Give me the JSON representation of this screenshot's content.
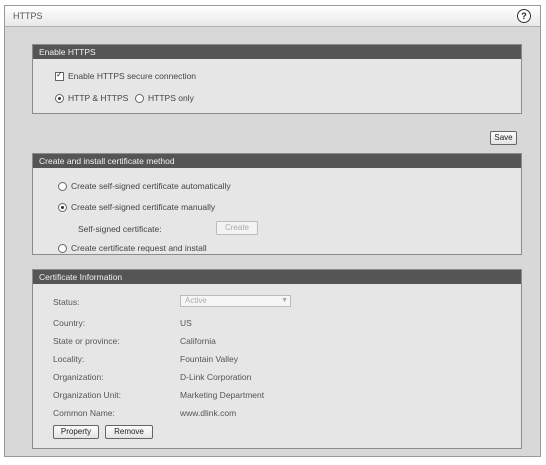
{
  "window": {
    "title": "HTTPS"
  },
  "enable_https": {
    "header": "Enable HTTPS",
    "secure_checkbox_label": "Enable HTTPS secure connection",
    "mode_options": [
      "HTTP & HTTPS",
      "HTTPS only"
    ],
    "mode_selected": "HTTP & HTTPS"
  },
  "save_label": "Save",
  "cert_method": {
    "header": "Create and install certificate method",
    "options": [
      "Create self-signed certificate automatically",
      "Create self-signed certificate manually",
      "Create certificate request and install"
    ],
    "selected": "Create self-signed certificate manually",
    "self_signed_label": "Self-signed certificate:",
    "create_button": "Create"
  },
  "cert_info": {
    "header": "Certificate Information",
    "status_label": "Status:",
    "status_value": "Active",
    "fields": [
      {
        "label": "Country:",
        "value": "US"
      },
      {
        "label": "State or province:",
        "value": "California"
      },
      {
        "label": "Locality:",
        "value": "Fountain Valley"
      },
      {
        "label": "Organization:",
        "value": "D-Link Corporation"
      },
      {
        "label": "Organization Unit:",
        "value": "Marketing Department"
      },
      {
        "label": "Common Name:",
        "value": "www.dlink.com"
      }
    ],
    "property_button": "Property",
    "remove_button": "Remove"
  }
}
